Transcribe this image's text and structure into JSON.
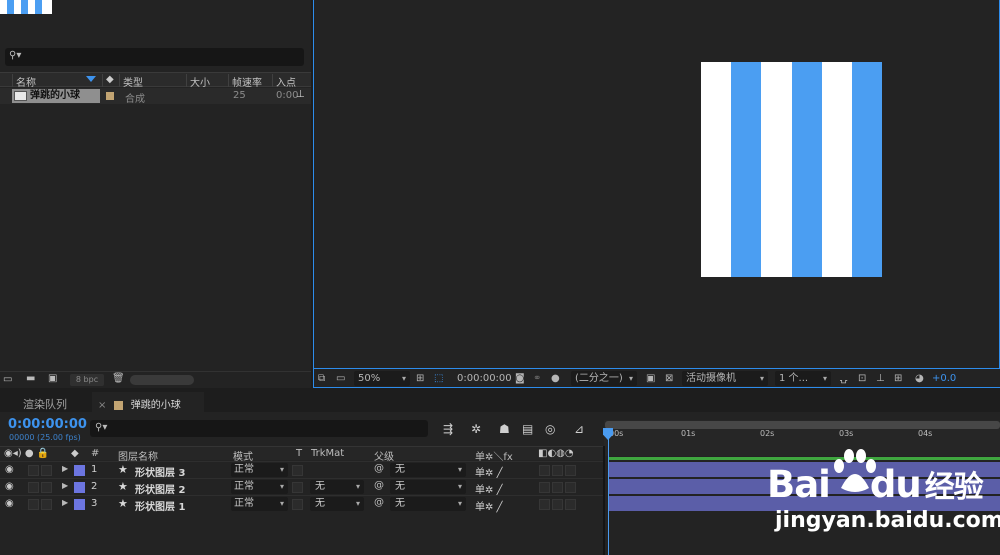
{
  "project": {
    "columns": [
      "名称",
      "类型",
      "大小",
      "帧速率",
      "入点"
    ],
    "item": {
      "name": "弹跳的小球",
      "type": "合成",
      "fps": "25",
      "in_point": "0:00"
    },
    "bpc": "8 bpc"
  },
  "viewer": {
    "stripe_colors": [
      "#ffffff",
      "#4b9ef2",
      "#ffffff",
      "#4b9ef2",
      "#ffffff",
      "#4b9ef2"
    ],
    "toolbar": {
      "zoom": "50%",
      "timecode": "0:00:00:00",
      "resolution": "(二分之一)",
      "camera": "活动摄像机",
      "views": "1 个...",
      "exposure": "+0.0"
    }
  },
  "timeline": {
    "tabs": {
      "render_queue": "渲染队列",
      "comp": "弹跳的小球",
      "close": "×",
      "menu": "≡"
    },
    "timecode": "0:00:00:00",
    "fps_label": "00000 (25.00 fps)",
    "headers": {
      "num": "#",
      "layer_name": "图层名称",
      "mode": "模式",
      "t": "T",
      "trkmat": "TrkMat",
      "parent": "父级",
      "switches": "单✲＼fx"
    },
    "ruler_ticks": [
      "00s",
      "01s",
      "02s",
      "03s",
      "04s"
    ],
    "layers": [
      {
        "num": "1",
        "name": "形状图层 3",
        "mode": "正常",
        "trkmat": "",
        "parent": "无"
      },
      {
        "num": "2",
        "name": "形状图层 2",
        "mode": "正常",
        "trkmat": "无",
        "parent": "无"
      },
      {
        "num": "3",
        "name": "形状图层 1",
        "mode": "正常",
        "trkmat": "无",
        "parent": "无"
      }
    ],
    "layer_color": "#6c75e0",
    "bar_color": "#5b5ea8"
  },
  "watermark": {
    "brand": "Bai",
    "brand2": "du",
    "cn": "经验",
    "url": "jingyan.baidu.com"
  },
  "accent": "#2d8ceb"
}
